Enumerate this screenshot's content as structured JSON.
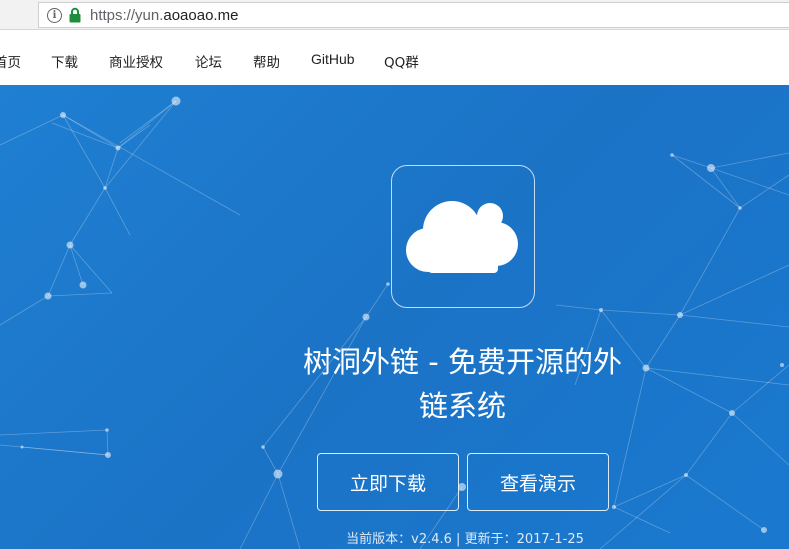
{
  "browser": {
    "url_scheme": "https://yun.",
    "url_domain": "aoaoao.me"
  },
  "nav": {
    "items": [
      {
        "label": "首页"
      },
      {
        "label": "下载"
      },
      {
        "label": "商业授权"
      },
      {
        "label": "论坛"
      },
      {
        "label": "帮助"
      },
      {
        "label": "GitHub"
      },
      {
        "label": "QQ群"
      }
    ]
  },
  "hero": {
    "title_line1": "树洞外链 - 免费开源的外",
    "title_line2": "链系统",
    "download_button": "立即下载",
    "demo_button": "查看演示",
    "version_label": "当前版本：",
    "version": "v2.4.6",
    "separator": " | ",
    "updated_label": "更新于：",
    "updated_date": "2017-1-25",
    "logo_icon": "cloud-icon"
  },
  "colors": {
    "hero_bg": "#1b73c6",
    "lock_green": "#1e8e3e"
  }
}
